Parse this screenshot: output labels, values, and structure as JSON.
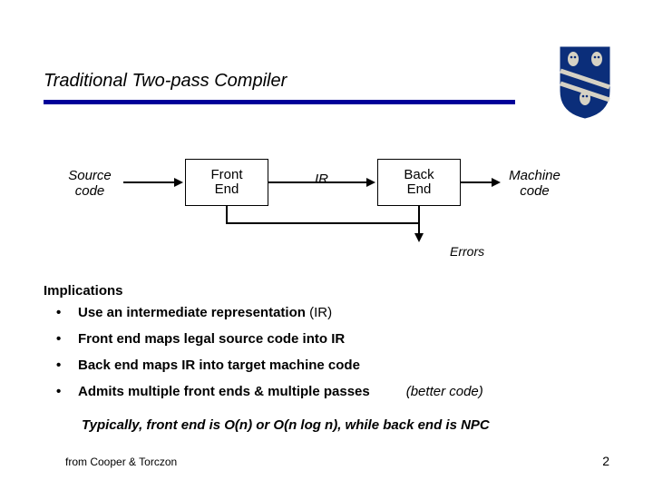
{
  "title": "Traditional Two-pass Compiler",
  "diagram": {
    "source_label": "Source\ncode",
    "front_box": "Front\nEnd",
    "ir_label": "IR",
    "back_box": "Back\nEnd",
    "machine_label": "Machine\ncode",
    "errors_label": "Errors"
  },
  "implications_heading": "Implications",
  "bullets": {
    "b1_main": "Use an intermediate representation ",
    "b1_suffix": "(IR)",
    "b2": "Front end maps legal source code into IR",
    "b3": "Back end maps IR into target machine code",
    "b4_main": "Admits multiple front ends & multiple passes",
    "b4_aside": "(better code)"
  },
  "typically": "Typically, front end is O(n) or O(n log n), while back end is NPC",
  "footer": {
    "credit": "from Cooper & Torczon",
    "page": "2"
  },
  "crest": {
    "name": "shield-crest-icon",
    "primary_color": "#0b2e7a",
    "owl_color": "#d6d2c4"
  }
}
